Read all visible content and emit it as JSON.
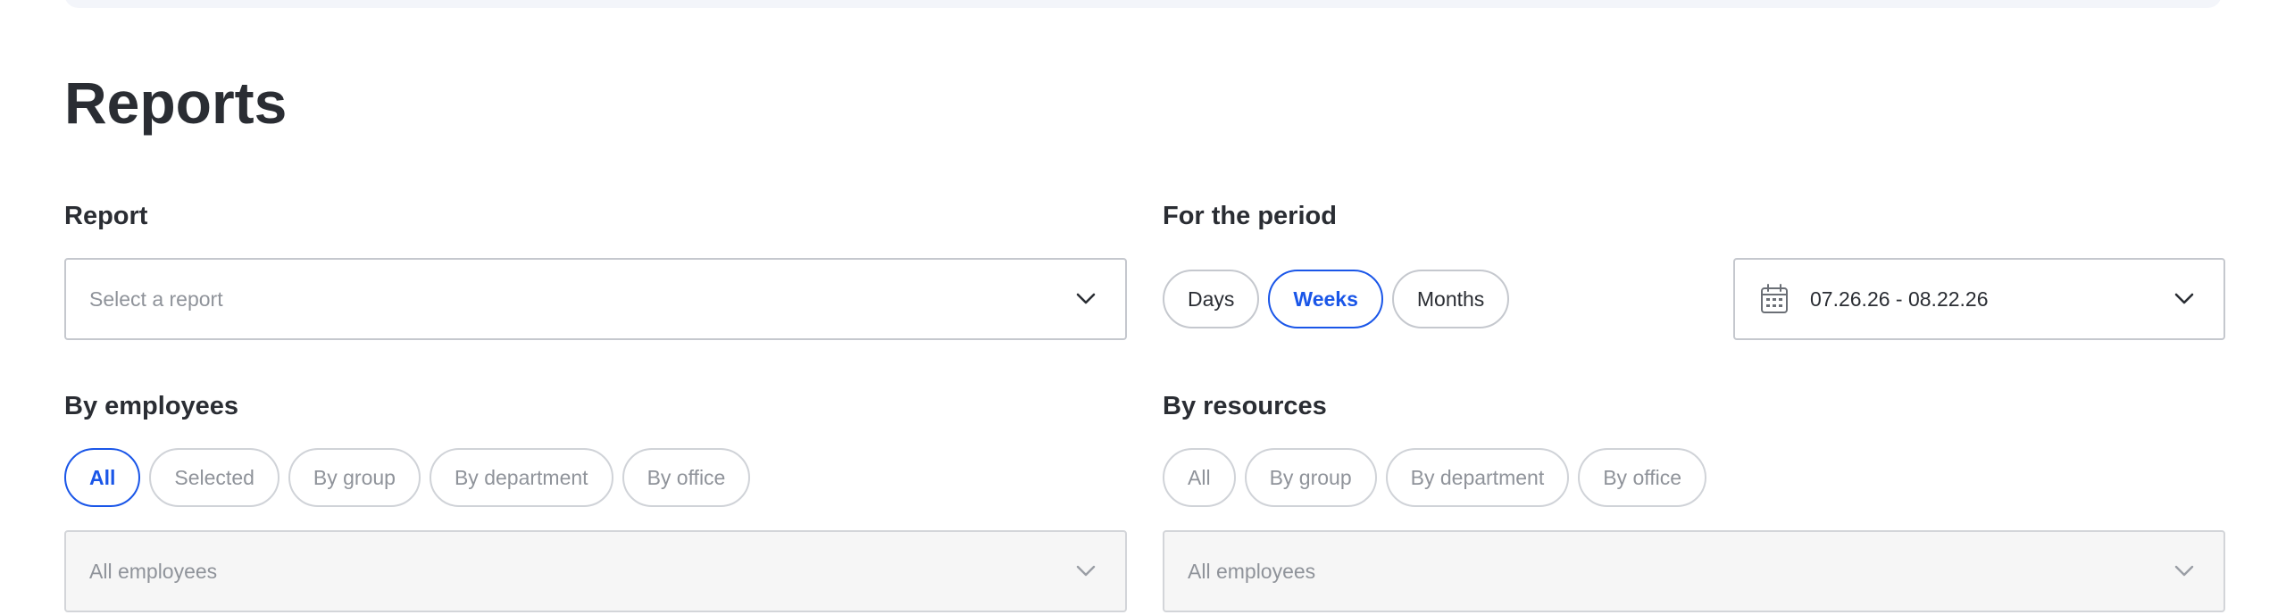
{
  "page": {
    "title": "Reports"
  },
  "report": {
    "label": "Report",
    "select_placeholder": "Select a report"
  },
  "period": {
    "label": "For the period",
    "options": [
      "Days",
      "Weeks",
      "Months"
    ],
    "selected": "Weeks",
    "date_range": "07.26.26 - 08.22.26"
  },
  "employees": {
    "label": "By employees",
    "filters": [
      "All",
      "Selected",
      "By group",
      "By department",
      "By office"
    ],
    "selected": "All",
    "select_value": "All employees"
  },
  "resources": {
    "label": "By resources",
    "filters": [
      "All",
      "By group",
      "By department",
      "By office"
    ],
    "select_value": "All employees"
  },
  "colors": {
    "accent": "#1a56e8",
    "text": "#2a2d33",
    "muted": "#8f939a",
    "border": "#c5c8ce",
    "disabled_bg": "#f6f6f6"
  },
  "icons": {
    "dropdown": "chevron-down-icon",
    "date": "calendar-icon"
  }
}
